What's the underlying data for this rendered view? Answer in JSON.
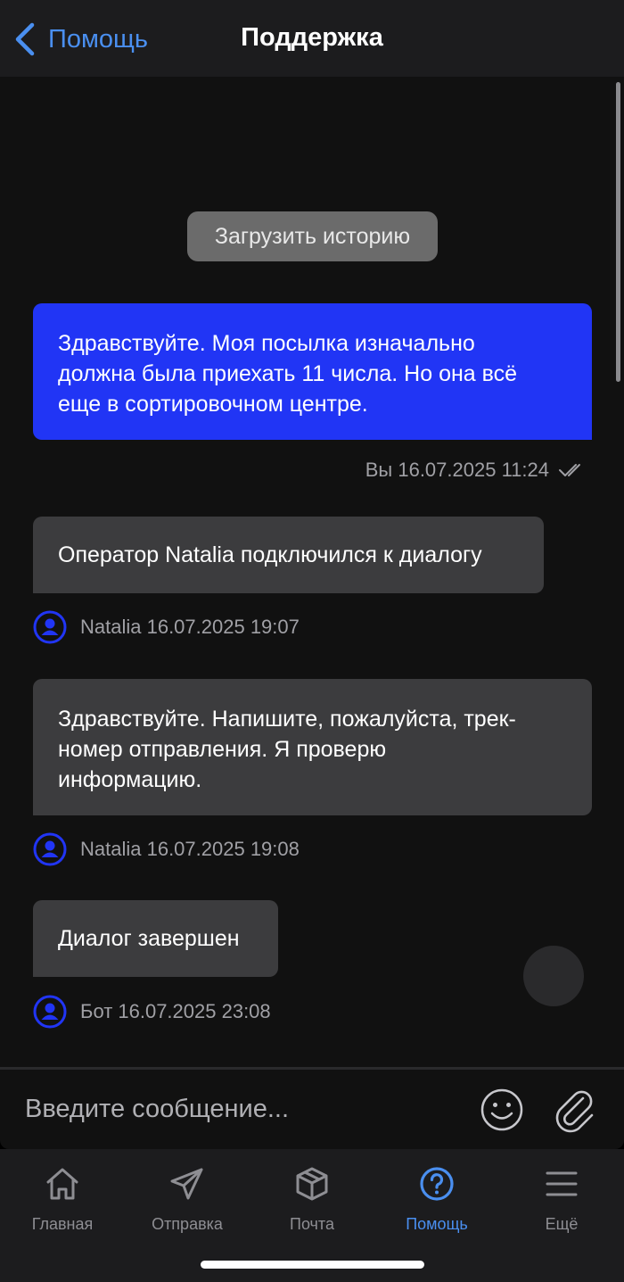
{
  "header": {
    "back_label": "Помощь",
    "title": "Поддержка"
  },
  "chat": {
    "load_history_label": "Загрузить историю",
    "messages": [
      {
        "lines": [
          "Здравствуйте. Моя посылка изначально",
          "должна была приехать 11 числа. Но она всё",
          "еще в сортировочном центре."
        ],
        "meta": "Вы 16.07.2025 11:24"
      },
      {
        "lines": [
          "Оператор Natalia подключился к диалогу"
        ],
        "meta": "Natalia 16.07.2025 19:07"
      },
      {
        "lines": [
          "Здравствуйте. Напишите, пожалуйста, трек-",
          "номер отправления. Я проверю",
          "информацию."
        ],
        "meta": "Natalia 16.07.2025 19:08"
      },
      {
        "lines": [
          "Диалог завершен"
        ],
        "meta": "Бот 16.07.2025 23:08"
      }
    ]
  },
  "input": {
    "placeholder": "Введите сообщение...",
    "value": ""
  },
  "tabs": [
    {
      "label": "Главная",
      "icon": "home-icon"
    },
    {
      "label": "Отправка",
      "icon": "paper-plane-icon"
    },
    {
      "label": "Почта",
      "icon": "package-icon"
    },
    {
      "label": "Помощь",
      "icon": "question-circle-icon",
      "active": true
    },
    {
      "label": "Ещё",
      "icon": "menu-icon"
    }
  ],
  "colors": {
    "accent": "#4a8ff0",
    "outgoing_bubble": "#2135f5",
    "incoming_bubble": "#3c3c3e",
    "avatar": "#2135f5"
  }
}
